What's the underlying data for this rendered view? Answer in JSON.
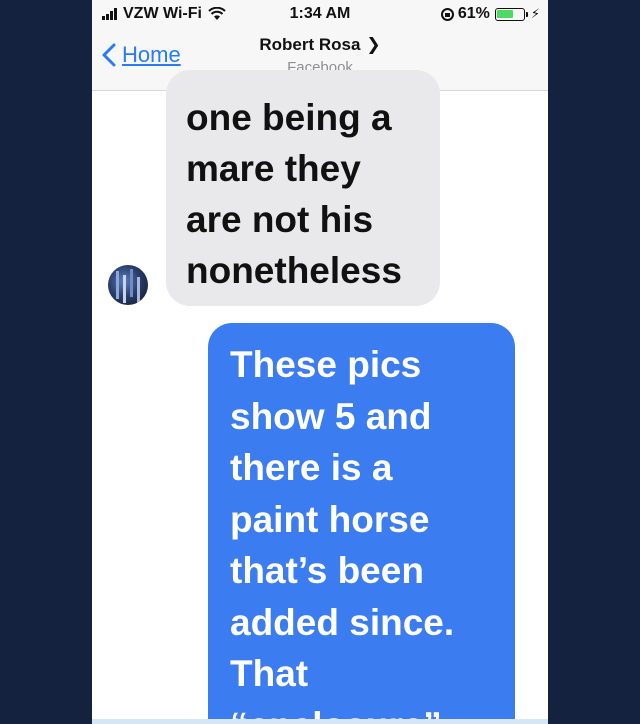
{
  "status_bar": {
    "carrier": "VZW Wi-Fi",
    "time": "1:34 AM",
    "battery_percent": "61%",
    "battery_level": 0.61,
    "icons": [
      "signal-icon",
      "wifi-icon",
      "rotation-lock-icon",
      "battery-icon",
      "charging-icon"
    ]
  },
  "nav": {
    "back_label": "Home",
    "contact_name": "Robert Rosa",
    "subtitle": "Facebook"
  },
  "messages": [
    {
      "direction": "incoming",
      "text": "one being a\nmare they\nare not his\nnonetheless"
    },
    {
      "direction": "outgoing",
      "text": "These pics\nshow 5 and\nthere is a\npaint horse\nthat’s been\nadded since.\nThat\n“enclosure”"
    }
  ],
  "colors": {
    "page_background": "#15223f",
    "accent": "#2a7bf5",
    "outgoing_bubble": "#3b7cf0",
    "incoming_bubble": "#e9e9eb",
    "battery": "#4cd964"
  }
}
